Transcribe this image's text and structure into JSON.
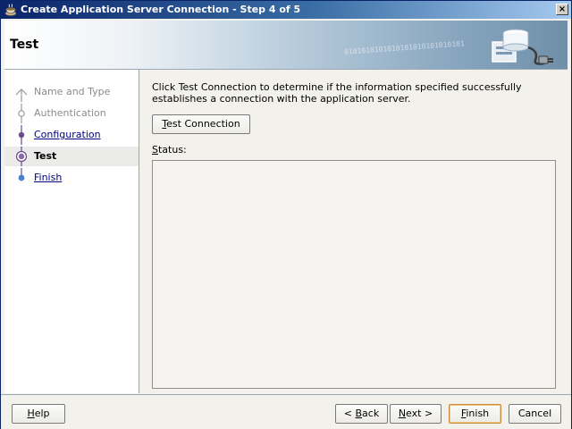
{
  "window": {
    "title": "Create Application Server Connection - Step 4 of 5",
    "close_glyph": "×"
  },
  "header": {
    "title": "Test",
    "binary_text": "0101010101010101010101010101"
  },
  "steps": [
    {
      "label": "Name and Type",
      "state": "disabled"
    },
    {
      "label": "Authentication",
      "state": "disabled"
    },
    {
      "label": "Configuration",
      "state": "link"
    },
    {
      "label": "Test",
      "state": "active"
    },
    {
      "label": "Finish",
      "state": "link"
    }
  ],
  "content": {
    "description": "Click Test Connection to determine if the information specified successfully establishes a connection with the application server.",
    "test_button": {
      "mnemonic": "T",
      "rest": "est Connection"
    },
    "status_label": {
      "mnemonic": "S",
      "rest": "tatus:"
    },
    "status_text": ""
  },
  "footer": {
    "help": {
      "mnemonic": "H",
      "rest": "elp"
    },
    "back": {
      "prefix": "< ",
      "mnemonic": "B",
      "rest": "ack"
    },
    "next": {
      "mnemonic": "N",
      "rest": "ext >"
    },
    "finish": {
      "mnemonic": "F",
      "rest": "inish"
    },
    "cancel": "Cancel"
  },
  "colors": {
    "title_bar_start": "#0a246a",
    "link": "#000080",
    "disabled": "#8c8c8c",
    "step_node": "#4a7fd4",
    "default_button_border": "#c98c3c"
  }
}
